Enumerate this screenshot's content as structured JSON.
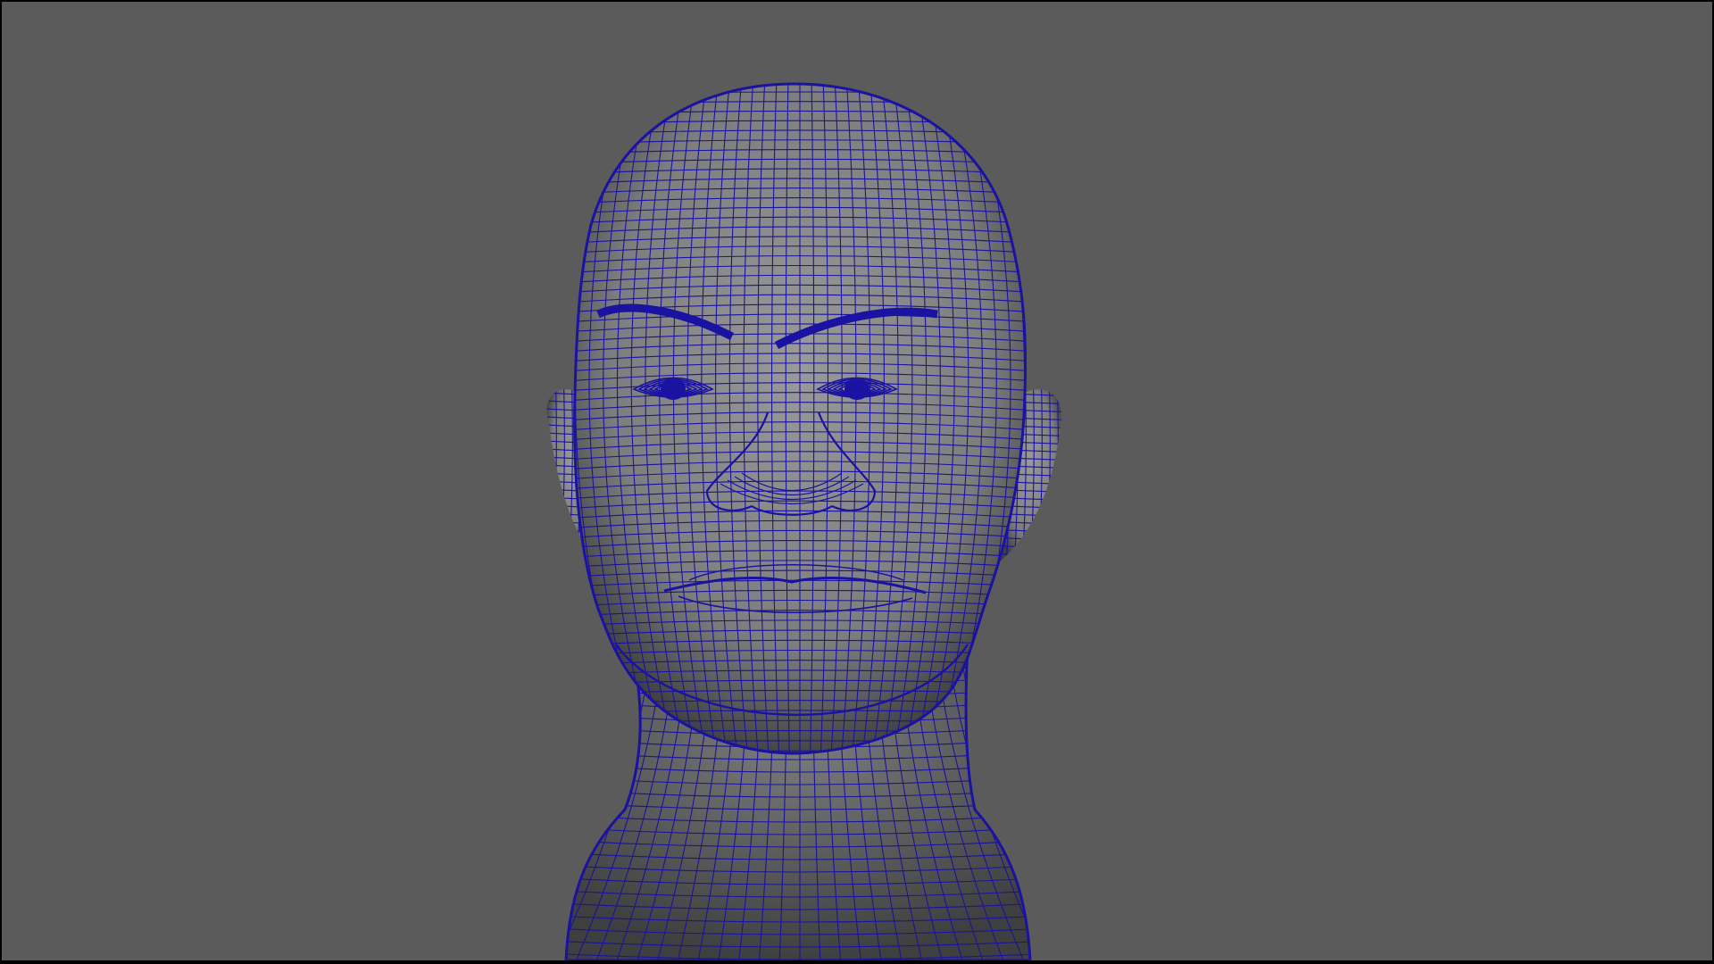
{
  "viewport": {
    "background_color": "#5b5b5b",
    "frame_color": "#000000"
  },
  "model": {
    "object": "head-mesh",
    "display_mode": "wireframe-on-shaded",
    "shaded_color": "#7d7d7d",
    "shaded_highlight": "#9a9a9a",
    "shaded_shadow": "#3f3f3f",
    "wireframe_color": "#1a12a0"
  }
}
